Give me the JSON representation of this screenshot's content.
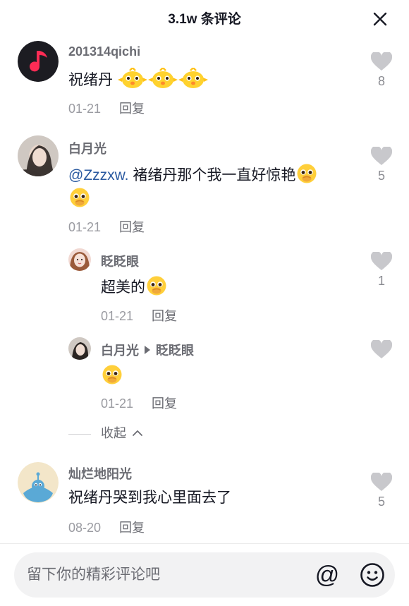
{
  "header": {
    "title": "3.1w 条评论"
  },
  "comments": [
    {
      "user": "201314qichi",
      "text": "祝绪丹",
      "date": "01-21",
      "reply": "回复",
      "likes": "8"
    },
    {
      "user": "白月光",
      "mention": "@Zzzxw.",
      "text": " 褚绪丹那个我一直好惊艳",
      "date": "01-21",
      "reply": "回复",
      "likes": "5"
    },
    {
      "user": "眨眨眼",
      "text": "超美的",
      "date": "01-21",
      "reply": "回复",
      "likes": "1"
    },
    {
      "user": "白月光",
      "reply_to": "眨眨眼",
      "date": "01-21",
      "reply": "回复"
    },
    {
      "user": "灿烂地阳光",
      "text": "祝绪丹哭到我心里面去了",
      "date": "08-20",
      "reply": "回复",
      "likes": "5"
    }
  ],
  "collapse_label": "收起",
  "input": {
    "placeholder": "留下你的精彩评论吧"
  },
  "icons": {
    "close": "close-icon",
    "like": "heart-icon",
    "at": "at-icon",
    "emoji": "smiley-icon",
    "music_app": "music-note-icon"
  },
  "colors": {
    "mention": "#2b5aa0",
    "like_heart": "#c8c8cc",
    "music_avatar": "#fe2c55"
  }
}
